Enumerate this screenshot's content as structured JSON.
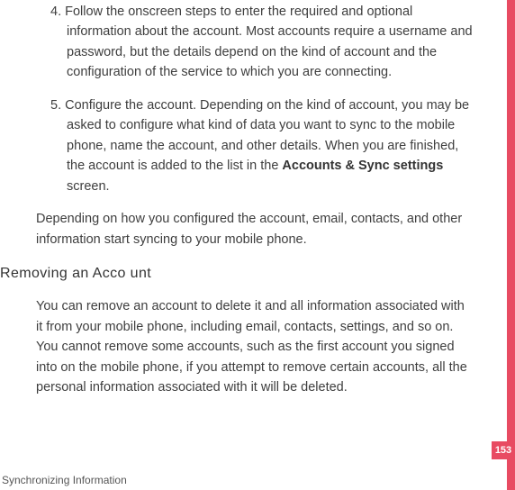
{
  "steps": [
    {
      "num": "4.",
      "body": "Follow the onscreen steps to enter the required and optional information about the account. Most accounts require a username and password, but the details depend on the kind of account and the configuration of the service to which you are connecting."
    },
    {
      "num": "5.",
      "body_pre": "Configure the account. Depending on the kind of account, you may be asked to configure what kind of data you want to sync to the mobile phone, name the account, and other details. When you are finished, the account is added to the list in the ",
      "emph": "Accounts & Sync settings",
      "body_post": " screen."
    }
  ],
  "trailing_para": "Depending on how you configured the account, email, contacts, and other information start syncing to your mobile phone.",
  "heading": "Removing an Acco unt",
  "remove_para": "You can remove an account to delete it and all information associated with it from your mobile phone, including email, contacts, settings, and so on. You cannot remove some accounts, such as the first account you signed into on the mobile phone,  if you attempt to remove certain accounts, all the personal information associated with it will be deleted.",
  "footer": "Synchronizing Information",
  "page_number": "153"
}
